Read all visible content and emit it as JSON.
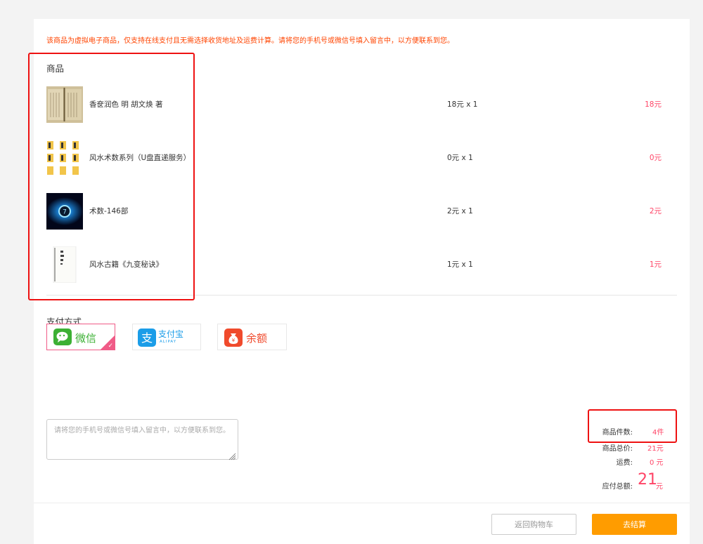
{
  "notice": "该商品为虚拟电子商品，仅支持在线支付且无需选择收货地址及运费计算。请将您的手机号或微信号填入留言中，以方便联系到您。",
  "products_title": "商品",
  "products": [
    {
      "name": "香奁润色 明 胡文焕 著",
      "price": "18元 x 1",
      "subtotal": "18元",
      "thumb_icon": "old-book-photo-icon"
    },
    {
      "name": "风水术数系列（U盘直递服务）",
      "price": "0元 x 1",
      "subtotal": "0元",
      "thumb_icon": "folder-grid-icon"
    },
    {
      "name": "术数-146部",
      "price": "2元 x 1",
      "subtotal": "2元",
      "thumb_icon": "glowing-orb-icon"
    },
    {
      "name": "风水古籍《九变秘诀》",
      "price": "1元 x 1",
      "subtotal": "1元",
      "thumb_icon": "manuscript-page-icon"
    }
  ],
  "payment_title": "支付方式",
  "payment": {
    "wechat": {
      "label": "微信",
      "icon": "wechat-icon",
      "color": "#3cb034"
    },
    "alipay": {
      "label": "支付宝",
      "sublabel": "ALIPAY",
      "icon": "alipay-icon",
      "color": "#1b9de8"
    },
    "balance": {
      "label": "余额",
      "icon": "money-bag-icon",
      "color": "#f04a2c"
    }
  },
  "message": {
    "placeholder": "请将您的手机号或微信号填入留言中，以方便联系到您。",
    "value": ""
  },
  "summary": {
    "count_label": "商品件数:",
    "count_value": "4件",
    "total_label": "商品总价:",
    "total_value": "21元",
    "shipping_label": "运费:",
    "shipping_value": "0 元",
    "payable_label": "应付总额:",
    "payable_amount": "21",
    "payable_unit": "元"
  },
  "buttons": {
    "back": "返回购物车",
    "checkout": "去结算"
  },
  "colors": {
    "accent_red": "#ff4466",
    "notice": "#ff4400",
    "checkout": "#ff9c00",
    "highlight_box": "#ee1111"
  }
}
